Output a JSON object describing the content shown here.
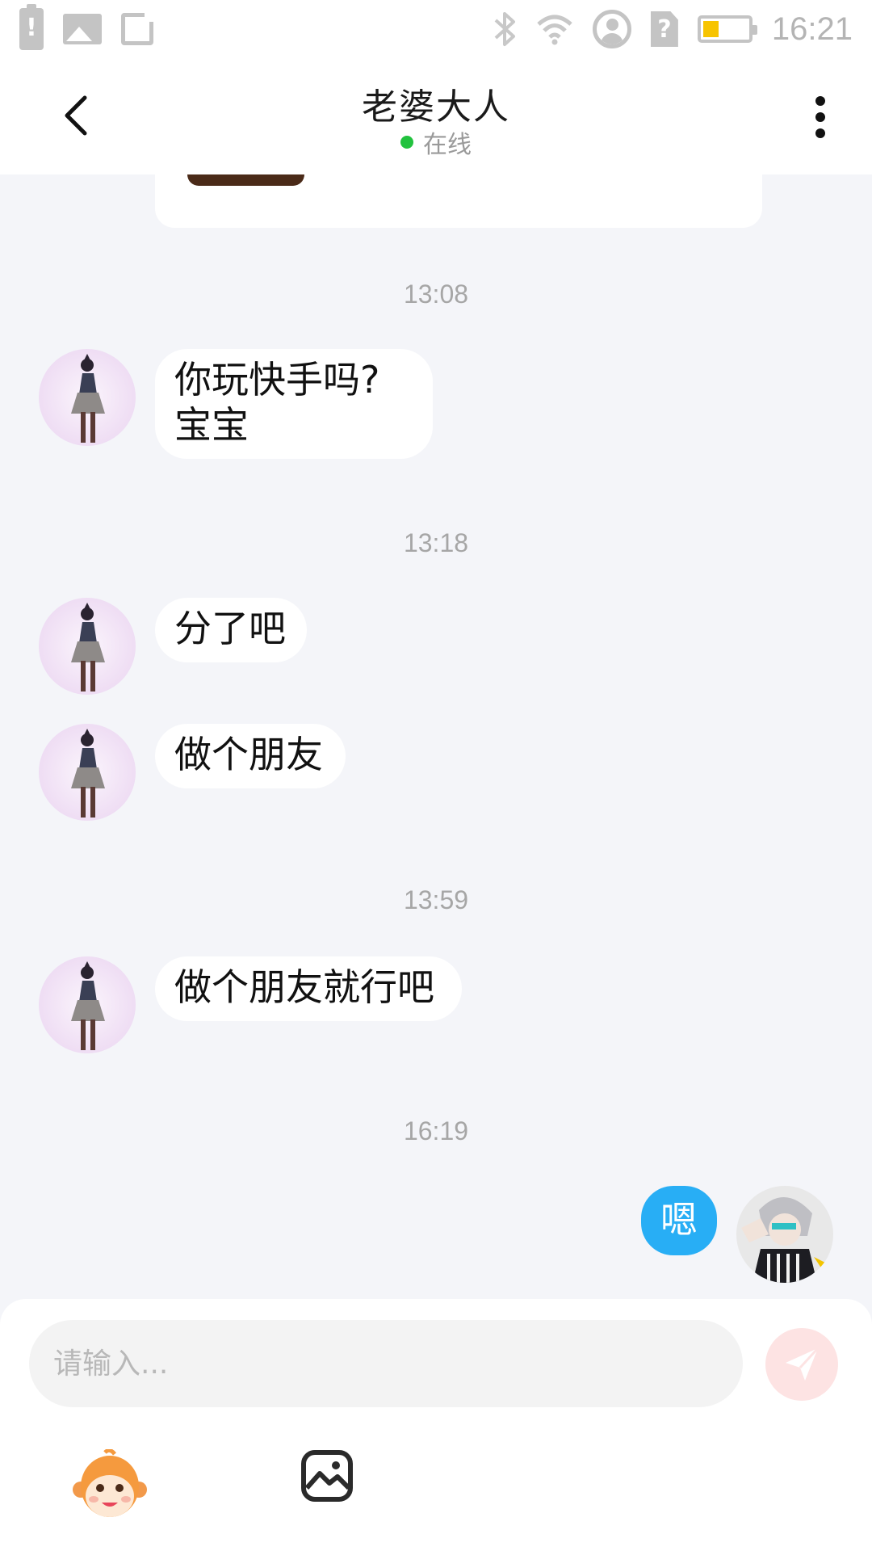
{
  "status_bar": {
    "battery_alert_glyph": "!",
    "sim_glyph": "?",
    "battery_level": 0.36,
    "time": "16:21",
    "icons": [
      "battery-alert-icon",
      "image-icon",
      "window-icon",
      "bluetooth-icon",
      "wifi-icon",
      "user-circle-icon",
      "sim-icon",
      "battery-icon"
    ]
  },
  "header": {
    "title": "老婆大人",
    "status": "在线",
    "status_color": "#22c23e",
    "back_icon": "chevron-left-icon",
    "menu_icon": "more-vertical-icon"
  },
  "messages": [
    {
      "type": "timestamp",
      "text": "13:08"
    },
    {
      "type": "incoming",
      "text": "你玩快手吗?\n宝宝"
    },
    {
      "type": "timestamp",
      "text": "13:18"
    },
    {
      "type": "incoming",
      "text": "分了吧"
    },
    {
      "type": "incoming",
      "text": "做个朋友"
    },
    {
      "type": "timestamp",
      "text": "13:59"
    },
    {
      "type": "incoming",
      "text": "做个朋友就行吧"
    },
    {
      "type": "timestamp",
      "text": "16:19"
    },
    {
      "type": "outgoing",
      "text": "嗯"
    }
  ],
  "composer": {
    "placeholder": "请输入...",
    "send_icon": "send-icon",
    "emoji_icon": "monkey-emoji-icon",
    "image_icon": "image-icon"
  },
  "colors": {
    "accent": "#28aef5",
    "background": "#f4f5f9",
    "send_disabled": "#fde3e3",
    "battery_fill": "#f7c400"
  }
}
